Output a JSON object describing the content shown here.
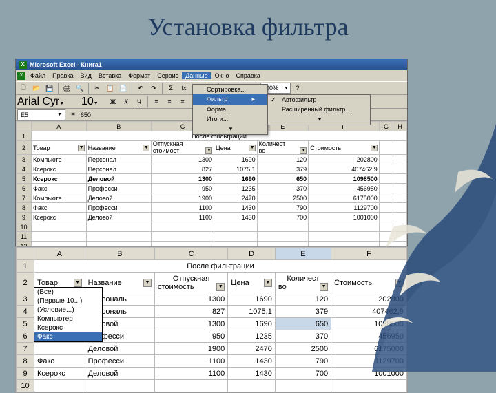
{
  "slide_title": "Установка фильтра",
  "titlebar": "Microsoft Excel - Книга1",
  "menu": [
    "Файл",
    "Правка",
    "Вид",
    "Вставка",
    "Формат",
    "Сервис",
    "Данные",
    "Окно",
    "Справка"
  ],
  "data_menu": {
    "sort": "Сортировка...",
    "filter": "Фильтр",
    "form": "Форма...",
    "totals": "Итоги..."
  },
  "filter_submenu": {
    "auto": "Автофильтр",
    "adv": "Расширенный фильтр..."
  },
  "font": {
    "name": "Arial Cyr",
    "size": "10"
  },
  "zoom": "100%",
  "cell": {
    "ref": "E5",
    "val": "650"
  },
  "cols_small": [
    "A",
    "B",
    "C",
    "D",
    "E",
    "F",
    "G",
    "H"
  ],
  "section_title": "После фильтрации",
  "headers": {
    "tovar": "Товар",
    "name": "Название",
    "otp1": "Отпускная",
    "otp2": "стоимост",
    "price": "Цена",
    "qty1": "Количест",
    "qty2": "во",
    "cost": "Стоимость"
  },
  "headers_big": {
    "otp2": "стоимость"
  },
  "rows": [
    {
      "n": "3",
      "a": "Компьюте",
      "b": "Персонал",
      "c": "1300",
      "d": "1690",
      "e": "120",
      "f": "202800"
    },
    {
      "n": "4",
      "a": "Ксерокс",
      "b": "Персонал",
      "c": "827",
      "d": "1075,1",
      "e": "379",
      "f": "407462,9"
    },
    {
      "n": "5",
      "a": "Ксерокс",
      "b": "Деловой",
      "c": "1300",
      "d": "1690",
      "e": "650",
      "f": "1098500",
      "bold": true
    },
    {
      "n": "6",
      "a": "Факс",
      "b": "Професси",
      "c": "950",
      "d": "1235",
      "e": "370",
      "f": "456950"
    },
    {
      "n": "7",
      "a": "Компьюте",
      "b": "Деловой",
      "c": "1900",
      "d": "2470",
      "e": "2500",
      "f": "6175000"
    },
    {
      "n": "8",
      "a": "Факс",
      "b": "Професси",
      "c": "1100",
      "d": "1430",
      "e": "790",
      "f": "1129700"
    },
    {
      "n": "9",
      "a": "Ксерокс",
      "b": "Деловой",
      "c": "1100",
      "d": "1430",
      "e": "700",
      "f": "1001000"
    }
  ],
  "big_cols": [
    "A",
    "B",
    "C",
    "D",
    "E",
    "F"
  ],
  "big_rows": [
    {
      "n": "3",
      "b": "Персональ",
      "c": "1300",
      "d": "1690",
      "e": "120",
      "f": "202800"
    },
    {
      "n": "4",
      "b": "Персональ",
      "c": "827",
      "d": "1075,1",
      "e": "379",
      "f": "407462,9"
    },
    {
      "n": "5",
      "b": "Деловой",
      "c": "1300",
      "d": "1690",
      "e": "650",
      "f": "1098500",
      "sel": true
    },
    {
      "n": "6",
      "b": "Професси",
      "c": "950",
      "d": "1235",
      "e": "370",
      "f": "456950"
    },
    {
      "n": "7",
      "b": "Деловой",
      "c": "1900",
      "d": "2470",
      "e": "2500",
      "f": "6175000"
    },
    {
      "n": "8",
      "a": "Факс",
      "b": "Професси",
      "c": "1100",
      "d": "1430",
      "e": "790",
      "f": "1129700"
    },
    {
      "n": "9",
      "a": "Ксерокс",
      "b": "Деловой",
      "c": "1100",
      "d": "1430",
      "e": "700",
      "f": "1001000"
    }
  ],
  "filter_opts": {
    "all": "(Все)",
    "top10": "(Первые 10...)",
    "cond": "(Условие...)",
    "o1": "Компьютер",
    "o2": "Ксерокс",
    "o3": "Факс"
  }
}
